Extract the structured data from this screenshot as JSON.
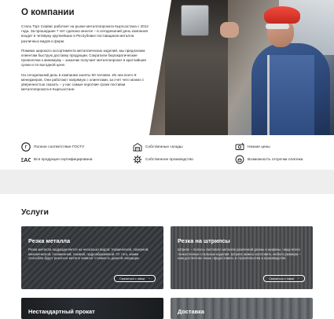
{
  "about": {
    "title": "О компании",
    "paragraphs": [
      "Сталь Торг Сервис работает на рынке металлопроката Кыргызстана с 2012 года. За прошедшие 7 лет сделано многое – в сегодняшний день компания входит в четвёрку крупнейших в Республике поставщиков металла различных видов и форм.",
      "Помимо широкого ассортимента металлических изделий, мы предлагаем клиентам быструю доставку продукции. Сократили бюрократические проволочки к минимуму – заказчик получает металлопрокат в кратчайшие сроки и по выгодной цене.",
      "На сегодняшний день в компании заняты 50 человек. Их них всего 8 менеджеров. Они работают напрямую с клиентами, за счет чего можно с уверенностью сказать – у нас самые короткие сроки поставки металлопроката в Кыргызстане."
    ]
  },
  "features": [
    {
      "icon": "gost-icon",
      "label": "Полное соответствие ГОСТУ"
    },
    {
      "icon": "eac-icon",
      "label": "Вся продукция сертифицирована"
    },
    {
      "icon": "warehouse-icon",
      "label": "Собственные склады"
    },
    {
      "icon": "factory-gear-icon",
      "label": "Собственное производство"
    },
    {
      "icon": "low-price-icon",
      "label": "Низкие цены"
    },
    {
      "icon": "deferred-payment-icon",
      "label": "Возможность отсрочки платежа"
    }
  ],
  "services": {
    "title": "Услуги",
    "cards": [
      {
        "title": "Резка металла",
        "desc": "Резка металла подразделяется на несколько видов: термической, лазерной, механической, плазменной, газовой, гидроабразивной. От того, каким способом будет резаться металл зависит стоимость данной операции.",
        "button": "Связаться с нами"
      },
      {
        "title": "Резка на штрипсы",
        "desc": "Штрипс – полосы листового металла различной длины и ширины, чаще всего тонкостенные стальные изделия. Штрипс можно изготовить любого размера – нам достаточно лишь предоставить в строительства и производстве.",
        "button": "Связаться с нами"
      },
      {
        "title": "Нестандартный прокат",
        "desc": "",
        "button": ""
      },
      {
        "title": "Доставка",
        "desc": "",
        "button": ""
      }
    ]
  },
  "colors": {
    "accent_dark": "#1d1d1d",
    "band": "#eeeeef",
    "card_overlay": "#141414"
  }
}
